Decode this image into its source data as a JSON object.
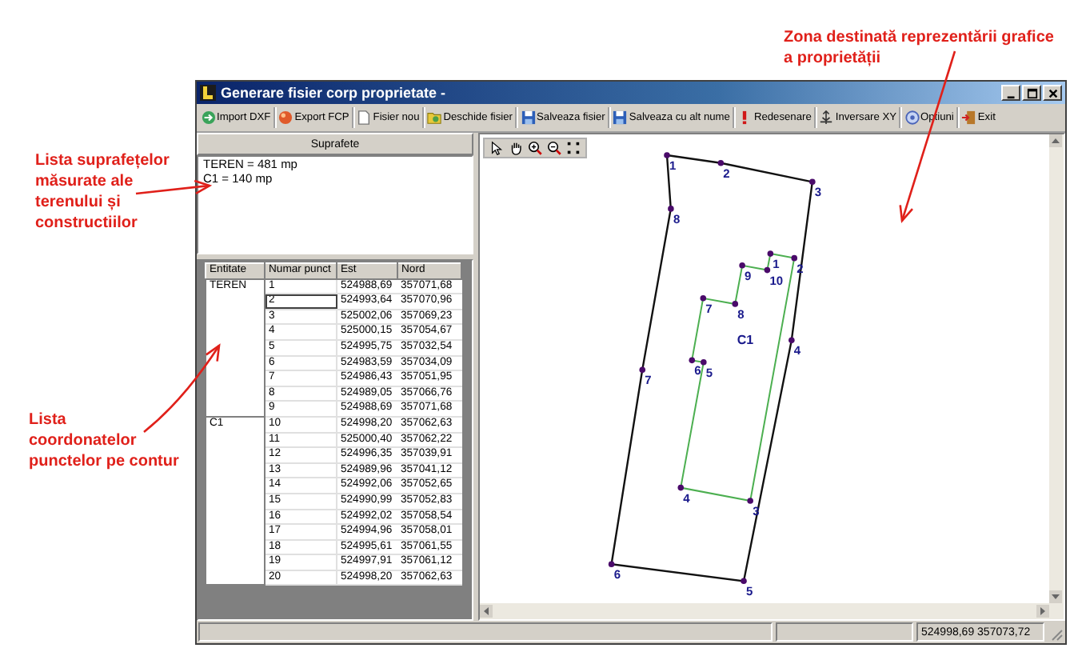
{
  "annotations": [
    {
      "text": "Lista suprafețelor\nmăsurate ale\nterenului și\nconstructiilor"
    },
    {
      "text": "Lista\ncoordonatelor\npunctelor pe contur"
    },
    {
      "text": "Zona destinată reprezentării grafice\na proprietății"
    }
  ],
  "window": {
    "title": "Generare fisier corp proprietate -"
  },
  "toolbar": [
    {
      "kind": "import",
      "label": "Import DXF"
    },
    {
      "kind": "export",
      "label": "Export FCP"
    },
    {
      "kind": "new",
      "label": "Fisier nou"
    },
    {
      "kind": "open",
      "label": "Deschide fisier"
    },
    {
      "kind": "save",
      "label": "Salveaza fisier"
    },
    {
      "kind": "save_as",
      "label": "Salveaza cu alt nume"
    },
    {
      "kind": "redraw",
      "label": "Redesenare"
    },
    {
      "kind": "swap",
      "label": "Inversare XY"
    },
    {
      "kind": "options",
      "label": "Optiuni"
    },
    {
      "kind": "exit",
      "label": "Exit"
    }
  ],
  "areas_panel": {
    "header": "Suprafete",
    "lines": [
      "TEREN = 481 mp",
      "C1 = 140 mp"
    ]
  },
  "points_table": {
    "columns": [
      "Entitate",
      "Numar punct",
      "Est",
      "Nord"
    ],
    "groups": [
      {
        "entity": "TEREN",
        "rows": [
          {
            "number": "1",
            "est": "524988,69",
            "nord": "357071,68",
            "selected": false
          },
          {
            "number": "2",
            "est": "524993,64",
            "nord": "357070,96",
            "selected": true
          },
          {
            "number": "3",
            "est": "525002,06",
            "nord": "357069,23",
            "selected": false
          },
          {
            "number": "4",
            "est": "525000,15",
            "nord": "357054,67",
            "selected": false
          },
          {
            "number": "5",
            "est": "524995,75",
            "nord": "357032,54",
            "selected": false
          },
          {
            "number": "6",
            "est": "524983,59",
            "nord": "357034,09",
            "selected": false
          },
          {
            "number": "7",
            "est": "524986,43",
            "nord": "357051,95",
            "selected": false
          },
          {
            "number": "8",
            "est": "524989,05",
            "nord": "357066,76",
            "selected": false
          },
          {
            "number": "9",
            "est": "524988,69",
            "nord": "357071,68",
            "selected": false
          }
        ]
      },
      {
        "entity": "C1",
        "rows": [
          {
            "number": "10",
            "est": "524998,20",
            "nord": "357062,63",
            "selected": false
          },
          {
            "number": "11",
            "est": "525000,40",
            "nord": "357062,22",
            "selected": false
          },
          {
            "number": "12",
            "est": "524996,35",
            "nord": "357039,91",
            "selected": false
          },
          {
            "number": "13",
            "est": "524989,96",
            "nord": "357041,12",
            "selected": false
          },
          {
            "number": "14",
            "est": "524992,06",
            "nord": "357052,65",
            "selected": false
          },
          {
            "number": "15",
            "est": "524990,99",
            "nord": "357052,83",
            "selected": false
          },
          {
            "number": "16",
            "est": "524992,02",
            "nord": "357058,54",
            "selected": false
          },
          {
            "number": "17",
            "est": "524994,96",
            "nord": "357058,01",
            "selected": false
          },
          {
            "number": "18",
            "est": "524995,61",
            "nord": "357061,55",
            "selected": false
          },
          {
            "number": "19",
            "est": "524997,91",
            "nord": "357061,12",
            "selected": false
          },
          {
            "number": "20",
            "est": "524998,20",
            "nord": "357062,63",
            "selected": false
          }
        ]
      }
    ]
  },
  "drawing": {
    "shapes": [
      {
        "kind": "parcel",
        "point_labels": [
          "1",
          "2",
          "3",
          "4",
          "5",
          "6",
          "7",
          "8"
        ]
      },
      {
        "kind": "building",
        "label": "C1",
        "point_labels": [
          "1",
          "2",
          "3",
          "4",
          "5",
          "6",
          "7",
          "8",
          "9",
          "10"
        ]
      }
    ]
  },
  "status_bar": {
    "coordinates": "524998,69 357073,72"
  }
}
